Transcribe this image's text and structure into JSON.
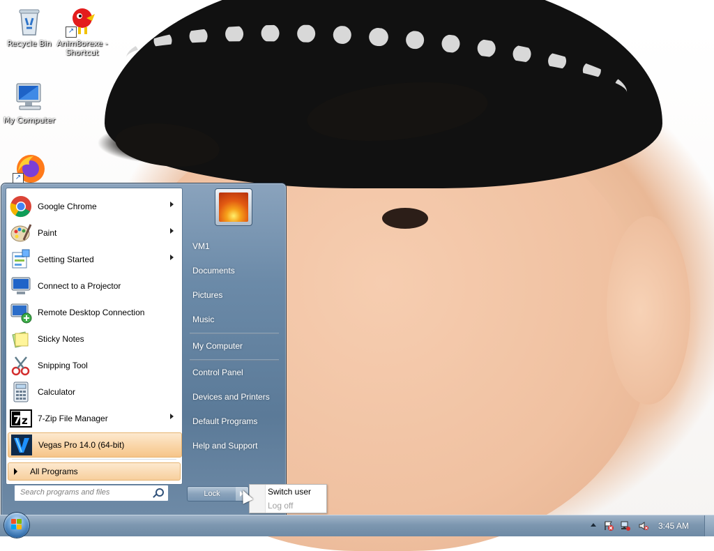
{
  "desktop": {
    "icons": [
      {
        "name": "recycle-bin",
        "label": "Recycle Bin"
      },
      {
        "name": "anim8or-shortcut",
        "label": "Anim8orexe - Shortcut"
      },
      {
        "name": "my-computer",
        "label": "My Computer"
      },
      {
        "name": "firefox-shortcut",
        "label": ""
      }
    ]
  },
  "start_menu": {
    "programs": [
      {
        "label": "Google Chrome",
        "icon": "chrome-icon",
        "submenu": true
      },
      {
        "label": "Paint",
        "icon": "paint-icon",
        "submenu": true
      },
      {
        "label": "Getting Started",
        "icon": "getting-started-icon",
        "submenu": true
      },
      {
        "label": "Connect to a Projector",
        "icon": "projector-icon",
        "submenu": false
      },
      {
        "label": "Remote Desktop Connection",
        "icon": "remote-desktop-icon",
        "submenu": false
      },
      {
        "label": "Sticky Notes",
        "icon": "sticky-notes-icon",
        "submenu": false
      },
      {
        "label": "Snipping Tool",
        "icon": "snipping-tool-icon",
        "submenu": false
      },
      {
        "label": "Calculator",
        "icon": "calculator-icon",
        "submenu": false
      },
      {
        "label": "7-Zip File Manager",
        "icon": "7zip-icon",
        "submenu": true
      },
      {
        "label": "Vegas Pro 14.0 (64-bit)",
        "icon": "vegas-icon",
        "submenu": false,
        "highlighted": true
      }
    ],
    "all_programs_label": "All Programs",
    "search_placeholder": "Search programs and files",
    "right_items": [
      {
        "label": "VM1"
      },
      {
        "label": "Documents"
      },
      {
        "label": "Pictures"
      },
      {
        "label": "Music"
      },
      {
        "label": "My Computer"
      },
      {
        "label": "Control Panel"
      },
      {
        "label": "Devices and Printers"
      },
      {
        "label": "Default Programs"
      },
      {
        "label": "Help and Support"
      }
    ],
    "lock_label": "Lock",
    "power_menu": {
      "switch_user": "Switch user",
      "log_off": "Log off"
    }
  },
  "taskbar": {
    "clock": "3:45 AM"
  },
  "colors": {
    "highlight": "#f9d3a3",
    "start_menu_right": "#6b8aa8",
    "taskbar": "#7d97b0"
  }
}
